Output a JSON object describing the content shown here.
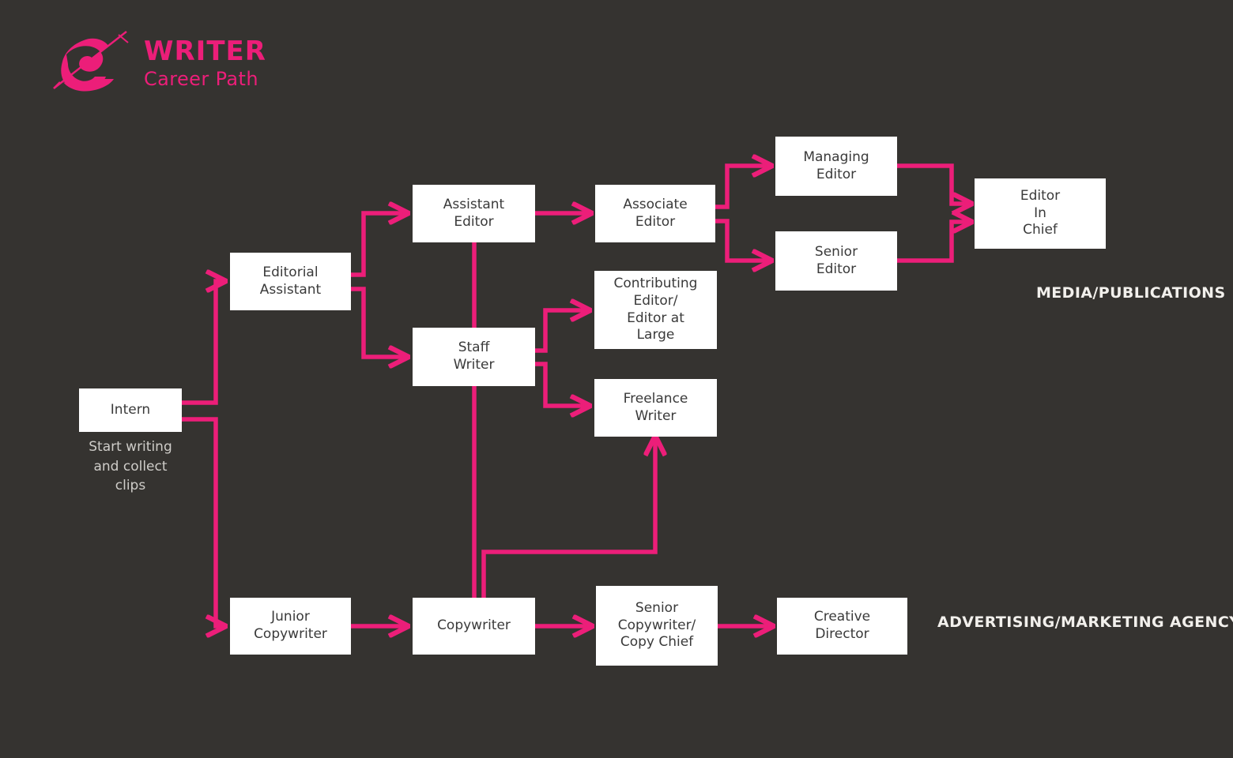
{
  "background_color": "#353330",
  "accent_color": "#EC1E79",
  "box_fill": "#FFFFFF",
  "box_text_color": "#3A3A3A",
  "logo": {
    "icon": "hand-writing-with-pen-icon",
    "title": "WRITER",
    "subtitle": "Career Path"
  },
  "sector_labels": {
    "media": "MEDIA/PUBLICATIONS",
    "advertising": "ADVERTISING/MARKETING AGENCY"
  },
  "captions": {
    "intern": "Start writing\nand collect\nclips"
  },
  "nodes": {
    "intern": "Intern",
    "editorial_assistant": "Editorial\nAssistant",
    "assistant_editor": "Assistant\nEditor",
    "staff_writer": "Staff\nWriter",
    "associate_editor": "Associate\nEditor",
    "contributing_editor": "Contributing\nEditor/\nEditor at\nLarge",
    "freelance_writer": "Freelance\nWriter",
    "managing_editor": "Managing\nEditor",
    "senior_editor": "Senior\nEditor",
    "editor_in_chief": "Editor\nIn\nChief",
    "junior_copywriter": "Junior\nCopywriter",
    "copywriter": "Copywriter",
    "senior_copywriter": "Senior\nCopywriter/\nCopy Chief",
    "creative_director": "Creative\nDirector"
  },
  "chart_data": {
    "type": "diagram",
    "title": "Writer Career Path",
    "diagram_kind": "flowchart",
    "tracks": [
      {
        "name": "MEDIA/PUBLICATIONS",
        "stages": [
          "Intern",
          "Editorial Assistant",
          "Assistant Editor",
          "Staff Writer",
          "Associate Editor",
          "Contributing Editor/Editor at Large",
          "Freelance Writer",
          "Managing Editor",
          "Senior Editor",
          "Editor In Chief"
        ]
      },
      {
        "name": "ADVERTISING/MARKETING AGENCY",
        "stages": [
          "Intern",
          "Junior Copywriter",
          "Copywriter",
          "Senior Copywriter/Copy Chief",
          "Creative Director"
        ]
      }
    ],
    "edges": [
      {
        "from": "Intern",
        "to": "Editorial Assistant"
      },
      {
        "from": "Intern",
        "to": "Junior Copywriter"
      },
      {
        "from": "Editorial Assistant",
        "to": "Assistant Editor"
      },
      {
        "from": "Editorial Assistant",
        "to": "Staff Writer"
      },
      {
        "from": "Assistant Editor",
        "to": "Associate Editor"
      },
      {
        "from": "Assistant Editor",
        "to": "Copywriter"
      },
      {
        "from": "Staff Writer",
        "to": "Contributing Editor/Editor at Large"
      },
      {
        "from": "Staff Writer",
        "to": "Freelance Writer"
      },
      {
        "from": "Associate Editor",
        "to": "Managing Editor"
      },
      {
        "from": "Associate Editor",
        "to": "Senior Editor"
      },
      {
        "from": "Managing Editor",
        "to": "Editor In Chief"
      },
      {
        "from": "Senior Editor",
        "to": "Editor In Chief"
      },
      {
        "from": "Junior Copywriter",
        "to": "Copywriter"
      },
      {
        "from": "Copywriter",
        "to": "Senior Copywriter/Copy Chief"
      },
      {
        "from": "Copywriter",
        "to": "Freelance Writer"
      },
      {
        "from": "Senior Copywriter/Copy Chief",
        "to": "Creative Director"
      }
    ]
  }
}
